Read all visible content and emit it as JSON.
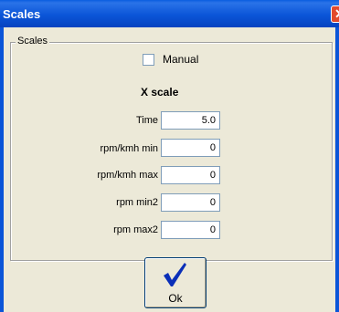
{
  "window": {
    "title": "Scales",
    "close_icon": "close-icon"
  },
  "group": {
    "legend": "Scales"
  },
  "manual": {
    "label": "Manual",
    "checked": false
  },
  "xscale": {
    "heading": "X scale"
  },
  "fields": [
    {
      "label": "Time",
      "value": "5.0"
    },
    {
      "label": "rpm/kmh min",
      "value": "0"
    },
    {
      "label": "rpm/kmh max",
      "value": "0"
    },
    {
      "label": "rpm min2",
      "value": "0"
    },
    {
      "label": "rpm max2",
      "value": "0"
    }
  ],
  "ok": {
    "label": "Ok",
    "icon": "checkmark-icon",
    "icon_color": "#0a2fb8"
  }
}
